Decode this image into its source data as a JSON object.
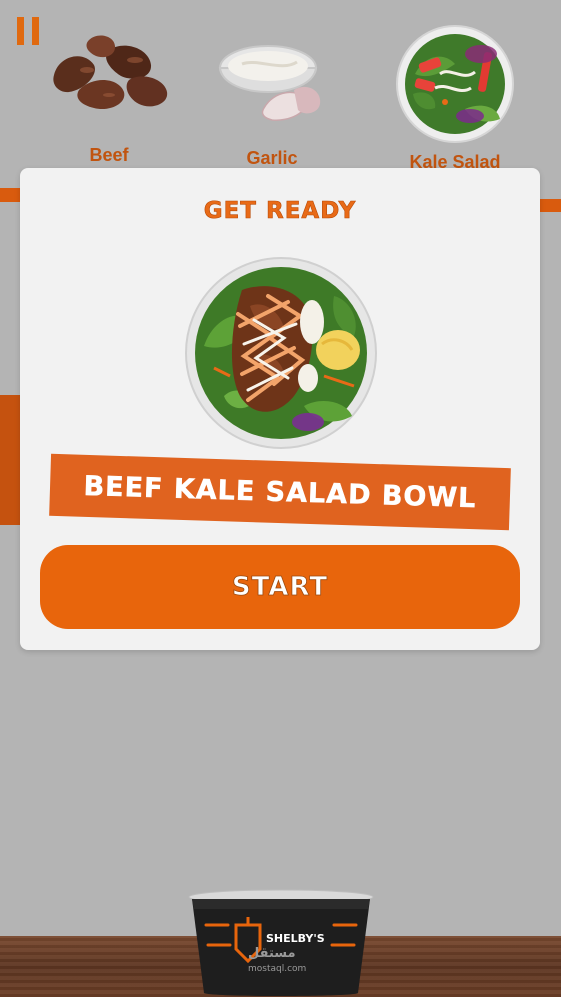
{
  "game": {
    "pause_icon": "pause-icon",
    "ingredients": [
      {
        "label": "Beef",
        "icon": "beef-icon"
      },
      {
        "label": "Garlic",
        "icon": "garlic-sauce-icon"
      },
      {
        "label": "Kale Salad",
        "icon": "kale-salad-icon"
      }
    ]
  },
  "modal": {
    "title": "GET READY",
    "recipe_name": "BEEF KALE SALAD BOWL",
    "start_label": "START"
  },
  "cup": {
    "brand": "SHELBY'S"
  },
  "watermark": {
    "text": "مستقل",
    "sub": "mostaql.com"
  },
  "colors": {
    "accent": "#e8650c",
    "label": "#c1540f",
    "background": "#b4b4b4",
    "modal": "#f2f2f2"
  }
}
